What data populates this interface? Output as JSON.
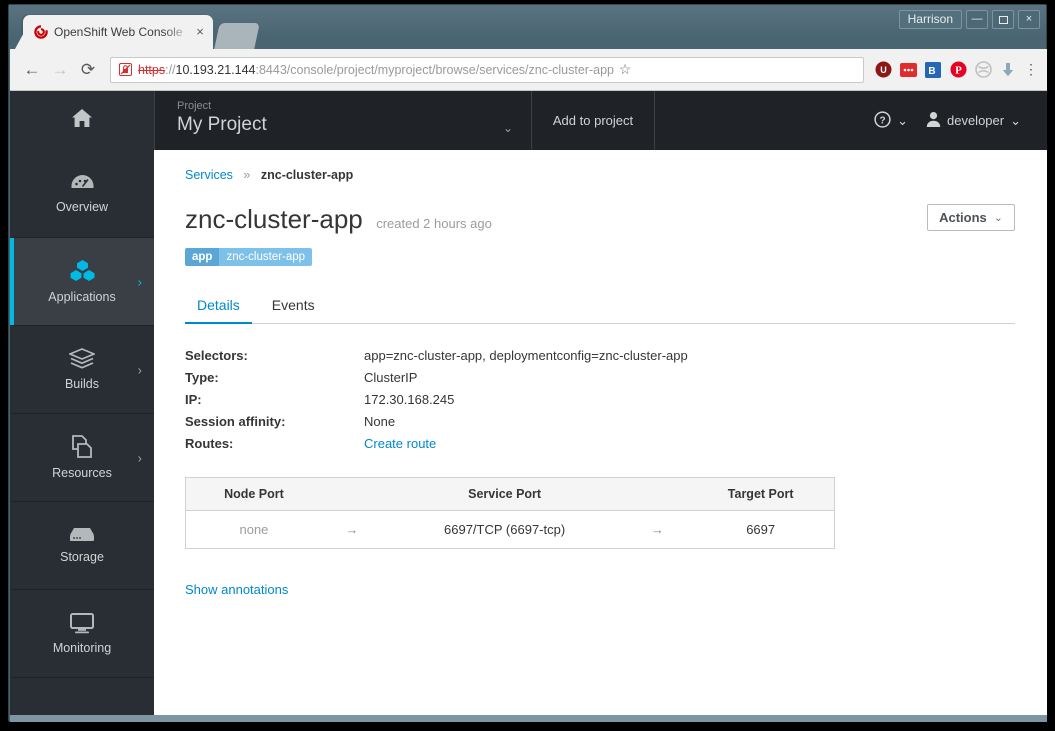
{
  "window": {
    "title_label": "Harrison",
    "minimize": "—",
    "maximize": "❐",
    "close": "×"
  },
  "browser": {
    "tab": {
      "title": "OpenShift Web Console",
      "favicon": "openshift-logo-icon",
      "close": "×"
    },
    "nav": {
      "back": "←",
      "forward": "→",
      "reload": "⟳"
    },
    "omnibox": {
      "security_icon": "insecure-lock-icon",
      "scheme": "https",
      "scheme_sep": "://",
      "host": "10.193.21.144",
      "port": ":8443",
      "path": "/console/project/myproject/browse/services/znc-cluster-app",
      "bookmark_star": "☆"
    },
    "extensions": [
      {
        "name": "ublock-origin-icon",
        "glyph": "U",
        "color": "#8e1616"
      },
      {
        "name": "adblock-icon",
        "glyph": "•••",
        "color": "#e02c2c"
      },
      {
        "name": "bitwarden-icon",
        "glyph": "B",
        "color": "#2567b5"
      },
      {
        "name": "pinterest-icon",
        "glyph": "P",
        "color": "#e60023"
      },
      {
        "name": "disconnect-icon",
        "glyph": "◌",
        "color": "#b9b9b9"
      },
      {
        "name": "download-icon",
        "glyph": "⬇",
        "color": "#8fa8b5"
      }
    ],
    "menu": "⋮"
  },
  "header": {
    "home_icon": "home-icon",
    "project_label": "Project",
    "project_name": "My Project",
    "project_caret": "⌄",
    "add_to_project": "Add to project",
    "help_icon": "help-circle-icon",
    "help_caret": "⌄",
    "user_icon": "user-avatar-icon",
    "user_name": "developer",
    "user_caret": "⌄"
  },
  "sidebar": {
    "items": [
      {
        "label": "Overview",
        "icon": "dashboard-icon",
        "active": false,
        "chevron": ""
      },
      {
        "label": "Applications",
        "icon": "cubes-icon",
        "active": true,
        "chevron": "›"
      },
      {
        "label": "Builds",
        "icon": "layers-icon",
        "active": false,
        "chevron": "›"
      },
      {
        "label": "Resources",
        "icon": "copy-pages-icon",
        "active": false,
        "chevron": "›"
      },
      {
        "label": "Storage",
        "icon": "storage-icon",
        "active": false,
        "chevron": ""
      },
      {
        "label": "Monitoring",
        "icon": "monitor-icon",
        "active": false,
        "chevron": ""
      }
    ]
  },
  "main": {
    "breadcrumb": {
      "parent": "Services",
      "separator": "»",
      "current": "znc-cluster-app"
    },
    "title": "znc-cluster-app",
    "subtitle": "created 2 hours ago",
    "actions_button": "Actions",
    "actions_caret": "⌄",
    "label_key": "app",
    "label_value": "znc-cluster-app",
    "tabs": [
      {
        "label": "Details",
        "active": true
      },
      {
        "label": "Events",
        "active": false
      }
    ],
    "details": [
      {
        "key": "Selectors:",
        "value": "app=znc-cluster-app, deploymentconfig=znc-cluster-app",
        "link": false
      },
      {
        "key": "Type:",
        "value": "ClusterIP",
        "link": false
      },
      {
        "key": "IP:",
        "value": "172.30.168.245",
        "link": false
      },
      {
        "key": "Session affinity:",
        "value": "None",
        "link": false
      },
      {
        "key": "Routes:",
        "value": "Create route",
        "link": true
      }
    ],
    "ports_table": {
      "headers": [
        "Node Port",
        "",
        "Service Port",
        "",
        "Target Port"
      ],
      "rows": [
        {
          "node_port": "none",
          "arrow1": "→",
          "service_port": "6697/TCP (6697-tcp)",
          "arrow2": "→",
          "target_port": "6697"
        }
      ]
    },
    "show_annotations": "Show annotations"
  },
  "colors": {
    "accent_blue": "#0088ce",
    "nav_dark": "#292e34",
    "nav_darker": "#1f2226",
    "active_cyan": "#00b9e4",
    "label_key_bg": "#5aa6d4",
    "label_val_bg": "#7ec1e8"
  }
}
